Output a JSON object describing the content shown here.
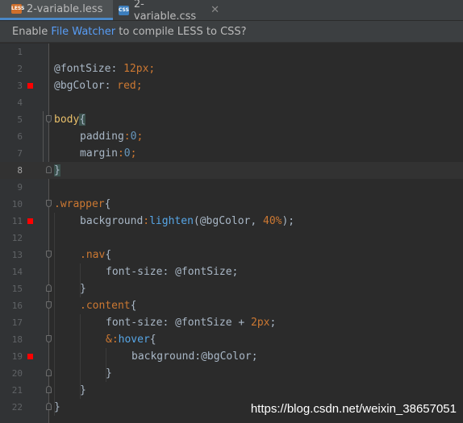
{
  "tabs": [
    {
      "label": "2-variable.less",
      "icon": "less-file-icon",
      "badge": "LESS",
      "active": true
    },
    {
      "label": "2-variable.css",
      "icon": "css-file-icon",
      "badge": "CSS",
      "active": false
    }
  ],
  "banner": {
    "prefix": "Enable ",
    "link": "File Watcher",
    "suffix": " to compile LESS to CSS?"
  },
  "lines": [
    {
      "n": "1"
    },
    {
      "n": "2"
    },
    {
      "n": "3"
    },
    {
      "n": "4"
    },
    {
      "n": "5"
    },
    {
      "n": "6"
    },
    {
      "n": "7"
    },
    {
      "n": "8"
    },
    {
      "n": "9"
    },
    {
      "n": "10"
    },
    {
      "n": "11"
    },
    {
      "n": "12"
    },
    {
      "n": "13"
    },
    {
      "n": "14"
    },
    {
      "n": "15"
    },
    {
      "n": "16"
    },
    {
      "n": "17"
    },
    {
      "n": "18"
    },
    {
      "n": "19"
    },
    {
      "n": "20"
    },
    {
      "n": "21"
    },
    {
      "n": "22"
    }
  ],
  "code": {
    "l2": {
      "a": "@fontSize",
      "b": ": ",
      "c": "12px",
      "d": ";"
    },
    "l3": {
      "a": "@bgColor",
      "b": ": ",
      "c": "red",
      "d": ";"
    },
    "l5": {
      "a": "body",
      "b": "{"
    },
    "l6": {
      "a": "padding",
      "b": ":",
      "c": "0",
      "d": ";"
    },
    "l7": {
      "a": "margin",
      "b": ":",
      "c": "0",
      "d": ";"
    },
    "l8": {
      "a": "}"
    },
    "l10": {
      "a": ".",
      "b": "wrapper",
      "c": "{"
    },
    "l11": {
      "a": "background",
      "b": ":",
      "c": "lighten",
      "d": "(@bgColor, ",
      "e": "40",
      "f": "%",
      "g": ");"
    },
    "l13": {
      "a": ".",
      "b": "nav",
      "c": "{"
    },
    "l14": {
      "a": "font-size",
      "b": ": @fontSize;"
    },
    "l15": {
      "a": "}"
    },
    "l16": {
      "a": ".",
      "b": "content",
      "c": "{"
    },
    "l17": {
      "a": "font-size",
      "b": ": @fontSize + ",
      "c": "2px",
      "d": ";"
    },
    "l18": {
      "a": "&",
      "b": ":",
      "c": "hover",
      "d": "{"
    },
    "l19": {
      "a": "background",
      "b": ":@bgColor;"
    },
    "l20": {
      "a": "}"
    },
    "l21": {
      "a": "}"
    },
    "l22": {
      "a": "}"
    }
  },
  "watermark": "https://blog.csdn.net/weixin_38657051",
  "colors": {
    "accent": "#589df6",
    "marker": "#ff0000",
    "background": "#2b2b2b"
  }
}
